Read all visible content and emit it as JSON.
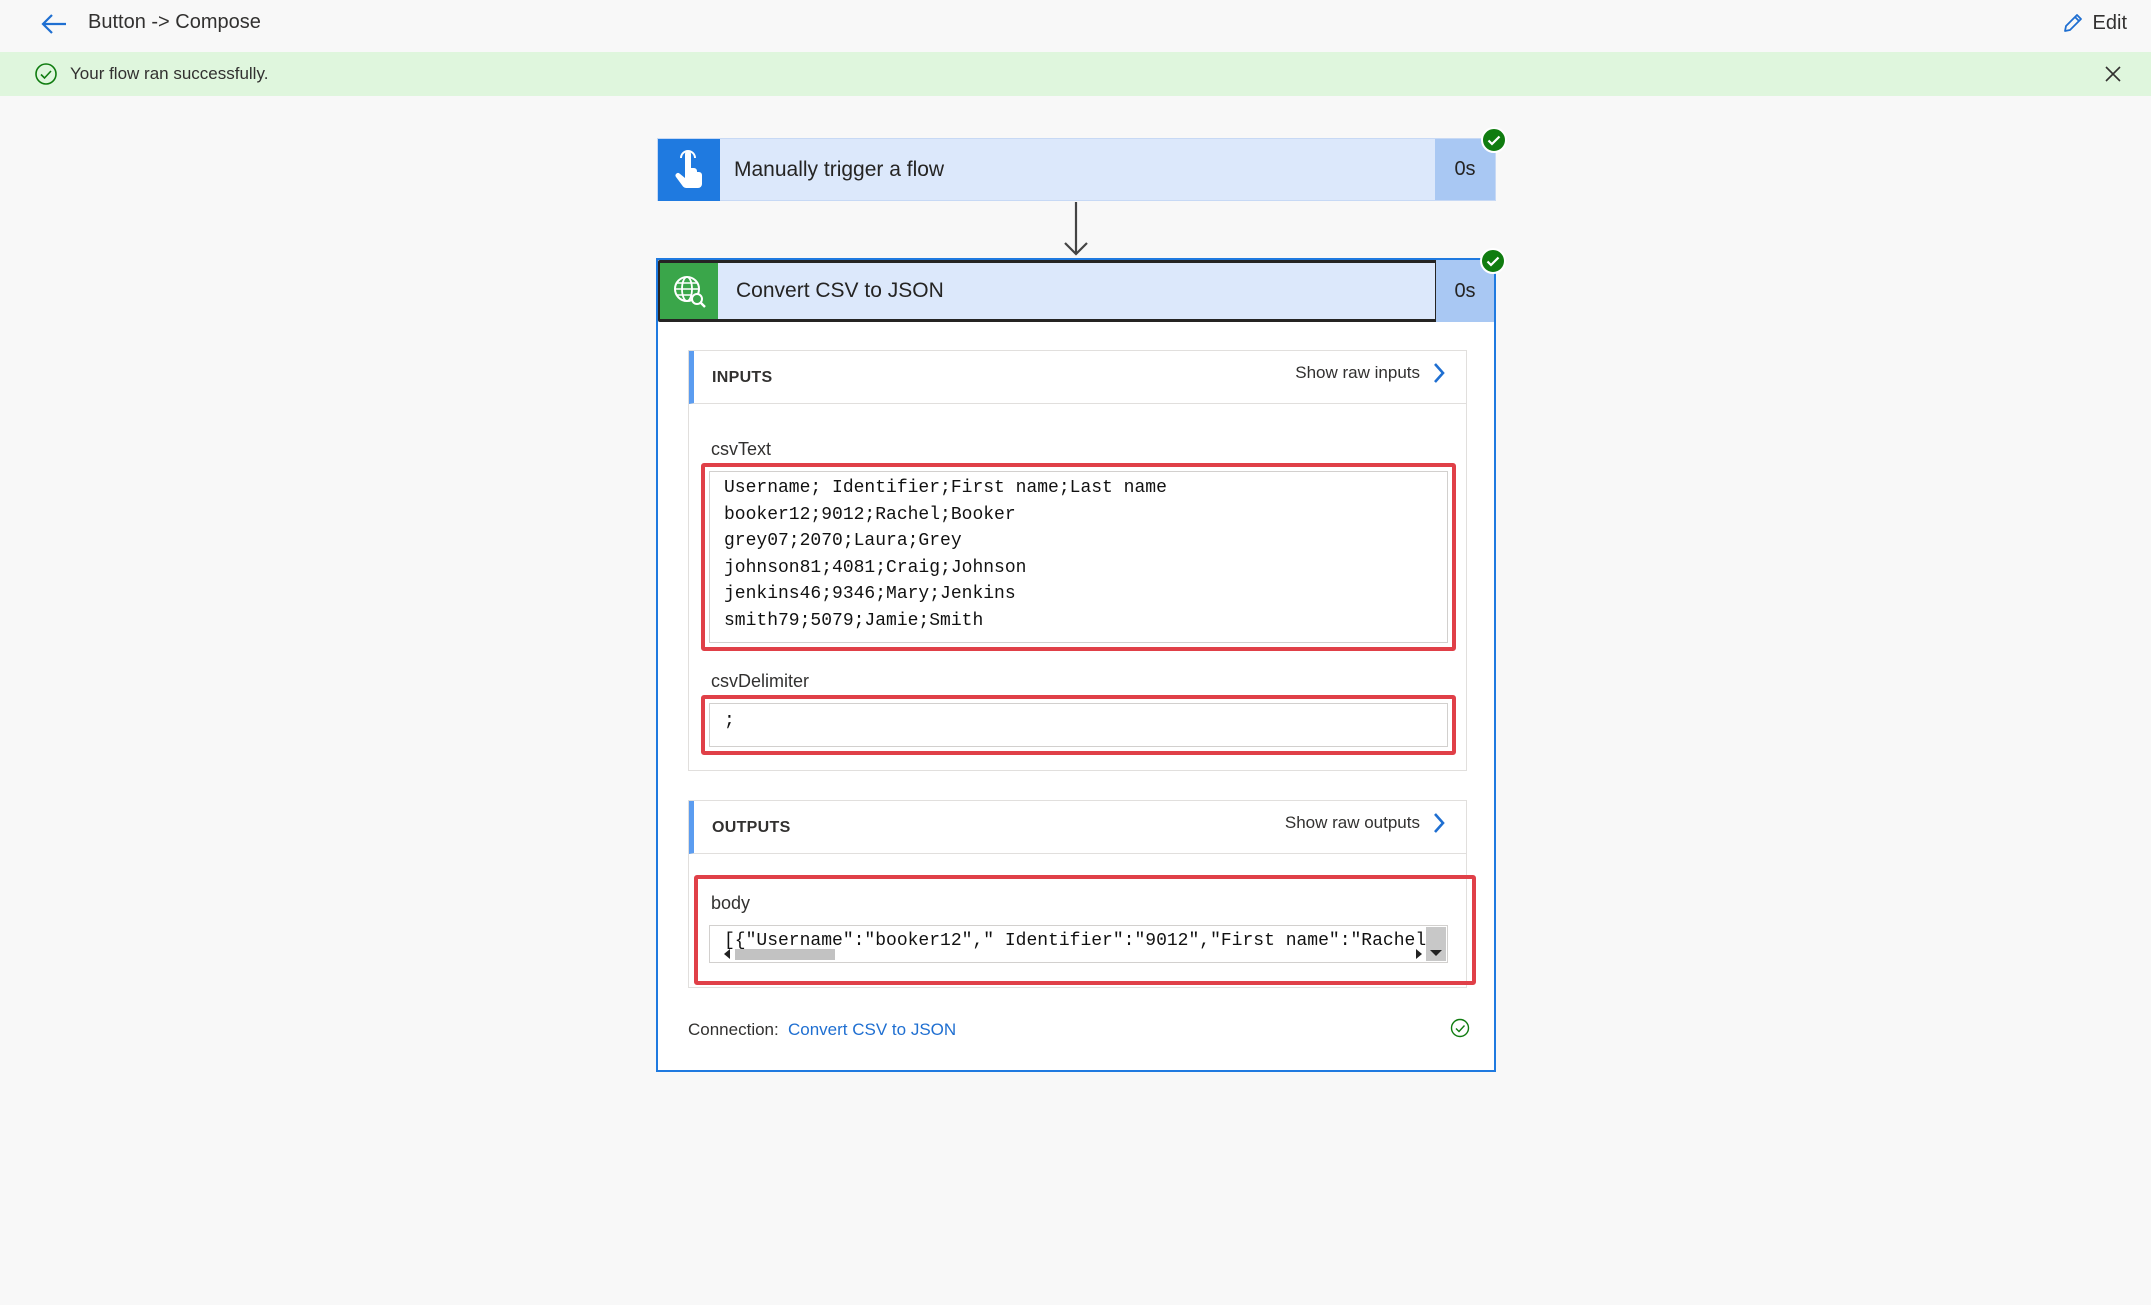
{
  "header": {
    "title": "Button -> Compose",
    "edit_label": "Edit"
  },
  "banner": {
    "message": "Your flow ran successfully."
  },
  "trigger_step": {
    "title": "Manually trigger a flow",
    "duration": "0s"
  },
  "action_step": {
    "title": "Convert CSV to JSON",
    "duration": "0s",
    "inputs": {
      "section_label": "INPUTS",
      "show_raw_label": "Show raw inputs",
      "csvText_label": "csvText",
      "csvText_value": "Username; Identifier;First name;Last name\nbooker12;9012;Rachel;Booker\ngrey07;2070;Laura;Grey\njohnson81;4081;Craig;Johnson\njenkins46;9346;Mary;Jenkins\nsmith79;5079;Jamie;Smith",
      "csvDelimiter_label": "csvDelimiter",
      "csvDelimiter_value": ";"
    },
    "outputs": {
      "section_label": "OUTPUTS",
      "show_raw_label": "Show raw outputs",
      "body_label": "body",
      "body_value": "[{\"Username\":\"booker12\",\" Identifier\":\"9012\",\"First name\":\"Rachel\""
    },
    "connection": {
      "label": "Connection:",
      "link_text": "Convert CSV to JSON"
    }
  },
  "colors": {
    "accent_blue": "#1f7ae0",
    "success_green": "#107c10",
    "highlight_red": "#e04048",
    "banner_bg": "#dff6dd"
  },
  "icons": [
    "back-arrow-icon",
    "pencil-icon",
    "check-circle-icon",
    "close-icon",
    "hand-pointer-icon",
    "globe-search-icon",
    "chevron-right-icon"
  ]
}
